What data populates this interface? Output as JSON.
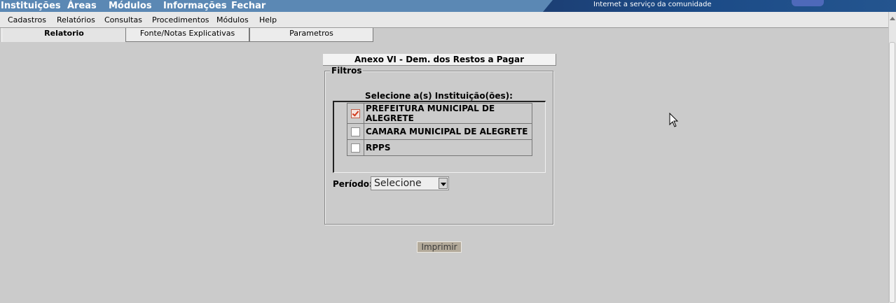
{
  "top_menu": [
    "Instituições",
    "Áreas",
    "Módulos",
    "Informações",
    "Fechar"
  ],
  "banner": {
    "tagline": "Internet a serviço da comunidade"
  },
  "sub_menu": [
    "Cadastros",
    "Relatórios",
    "Consultas",
    "Procedimentos",
    "Módulos",
    "Help"
  ],
  "tabs": [
    {
      "label": "Relatorio",
      "active": true
    },
    {
      "label": "Fonte/Notas Explicativas",
      "active": false
    },
    {
      "label": "Parametros",
      "active": false
    }
  ],
  "report": {
    "title": "Anexo VI - Dem. dos Restos a Pagar",
    "filters_legend": "Filtros",
    "institutions_heading": "Selecione a(s) Instituição(ões):",
    "institutions": [
      {
        "name": "PREFEITURA MUNICIPAL DE ALEGRETE",
        "checked": true
      },
      {
        "name": "CAMARA MUNICIPAL DE ALEGRETE",
        "checked": false
      },
      {
        "name": "RPPS",
        "checked": false
      }
    ],
    "periodo_label": "Período:",
    "periodo_value": "Selecione",
    "print_label": "Imprimir"
  },
  "colors": {
    "topbar": "#5b88b4",
    "banner": "#1b4a86",
    "background": "#cbcbcb",
    "print_button": "#b3aa9a"
  }
}
